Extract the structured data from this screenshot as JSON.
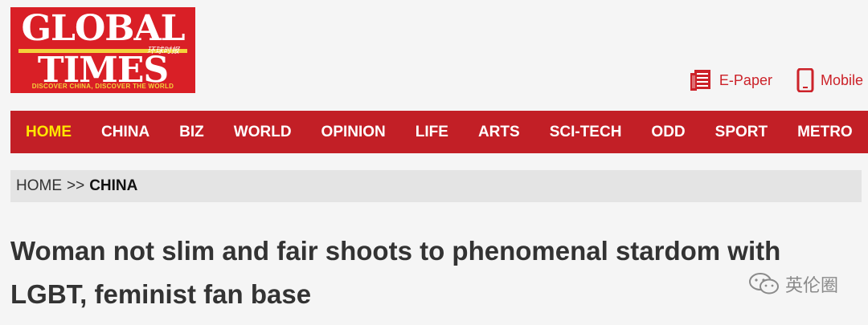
{
  "logo": {
    "line1": "GLOBAL",
    "line2": "TIMES",
    "chinese": "环球时报",
    "tagline": "DISCOVER CHINA, DISCOVER THE WORLD"
  },
  "toplinks": {
    "epaper": "E-Paper",
    "mobile": "Mobile"
  },
  "nav": {
    "items": [
      "HOME",
      "CHINA",
      "BIZ",
      "WORLD",
      "OPINION",
      "LIFE",
      "ARTS",
      "SCI-TECH",
      "ODD",
      "SPORT",
      "METRO"
    ],
    "active_color": "#ffe600",
    "bg_color": "#c21f26"
  },
  "breadcrumb": {
    "home": "HOME",
    "separator": ">>",
    "current": "CHINA"
  },
  "article": {
    "title": "Woman not slim and fair shoots to phenomenal stardom with LGBT, feminist fan base"
  },
  "watermark": {
    "text": "英伦圈",
    "icon": "wechat-icon"
  }
}
